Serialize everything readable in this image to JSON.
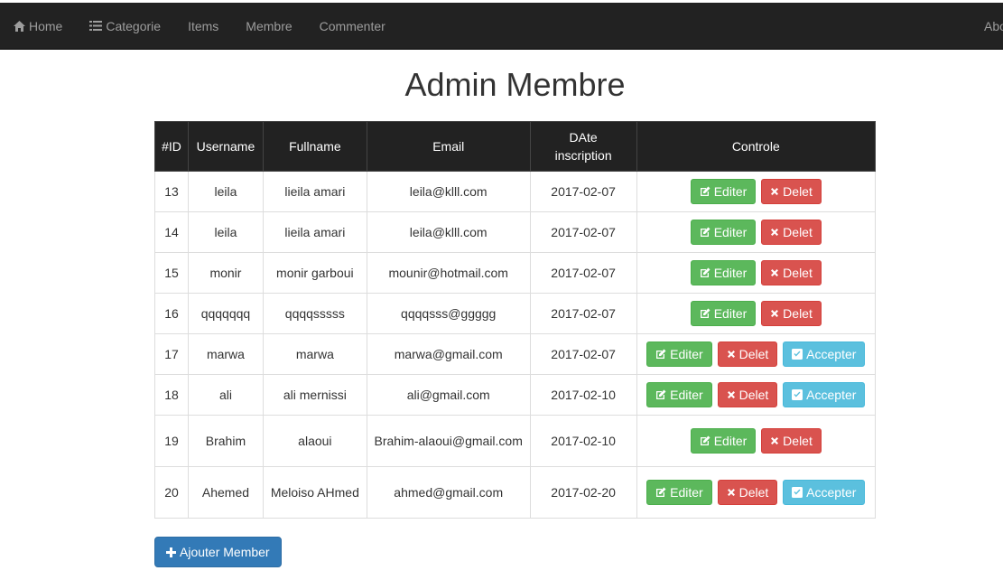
{
  "nav": {
    "home": "Home",
    "categorie": "Categorie",
    "items": "Items",
    "membre": "Membre",
    "commenter": "Commenter",
    "right": "Abo"
  },
  "page": {
    "title": "Admin Membre"
  },
  "table": {
    "headers": {
      "id": "#ID",
      "username": "Username",
      "fullname": "Fullname",
      "email": "Email",
      "date": "DAte inscription",
      "controle": "Controle"
    },
    "rows": [
      {
        "id": "13",
        "username": "leila",
        "fullname": "lieila amari",
        "email": "leila@klll.com",
        "date": "2017-02-07"
      },
      {
        "id": "14",
        "username": "leila",
        "fullname": "lieila amari",
        "email": "leila@klll.com",
        "date": "2017-02-07"
      },
      {
        "id": "15",
        "username": "monir",
        "fullname": "monir garboui",
        "email": "mounir@hotmail.com",
        "date": "2017-02-07"
      },
      {
        "id": "16",
        "username": "qqqqqqq",
        "fullname": "qqqqsssss",
        "email": "qqqqsss@ggggg",
        "date": "2017-02-07"
      },
      {
        "id": "17",
        "username": "marwa",
        "fullname": "marwa",
        "email": "marwa@gmail.com",
        "date": "2017-02-07"
      },
      {
        "id": "18",
        "username": "ali",
        "fullname": "ali mernissi",
        "email": "ali@gmail.com",
        "date": "2017-02-10"
      },
      {
        "id": "19",
        "username": "Brahim",
        "fullname": "alaoui",
        "email": "Brahim-alaoui@gmail.com",
        "date": "2017-02-10"
      },
      {
        "id": "20",
        "username": "Ahemed",
        "fullname": "Meloiso AHmed",
        "email": "ahmed@gmail.com",
        "date": "2017-02-20"
      }
    ]
  },
  "buttons": {
    "edit": "Editer",
    "delete": "Delet",
    "accept": "Accepter",
    "add": "Ajouter Member"
  },
  "colors": {
    "navbar": "#222222",
    "success": "#5cb85c",
    "danger": "#d9534f",
    "info": "#5bc0de",
    "primary": "#337ab7"
  }
}
